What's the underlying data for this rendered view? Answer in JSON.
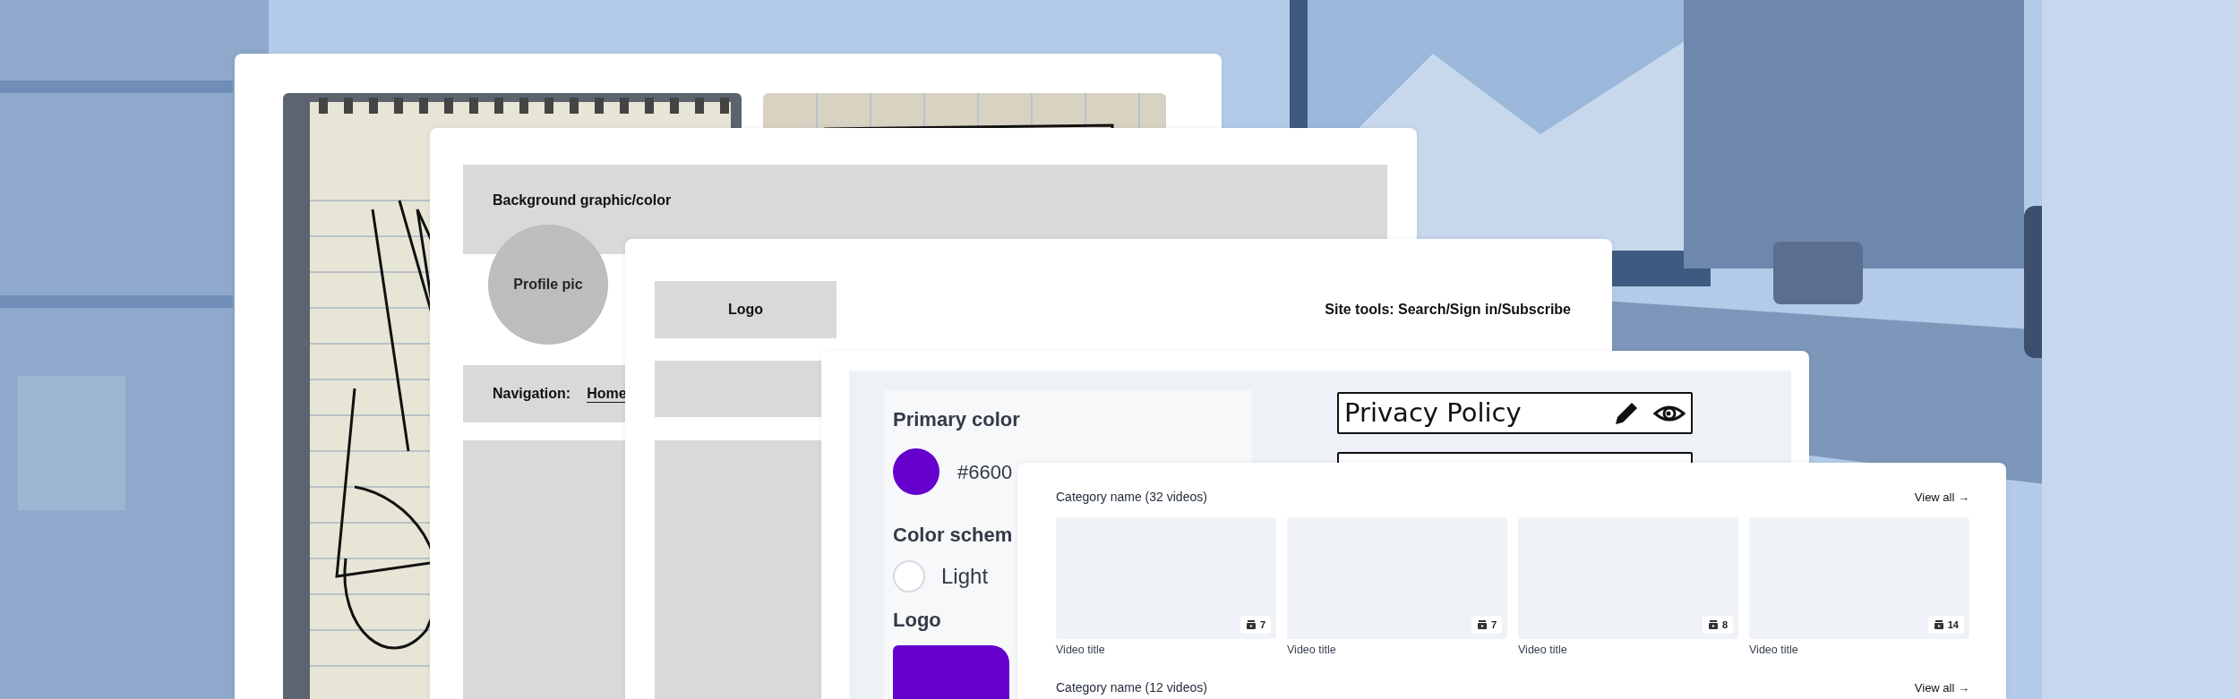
{
  "profile_wireframe": {
    "banner_label": "Background graphic/color",
    "avatar_label": "Profile pic",
    "nav_label": "Navigation:",
    "nav_links": [
      "Home"
    ]
  },
  "header_wireframe": {
    "logo_label": "Logo",
    "tools_label": "Site tools: Search/Sign in/Subscribe"
  },
  "theme_settings": {
    "primary_color": {
      "label": "Primary color",
      "color": "#6600cc",
      "value": "#6600"
    },
    "color_scheme": {
      "label": "Color schem",
      "options": [
        {
          "label": "Light",
          "selected": false
        }
      ]
    },
    "logo": {
      "label": "Logo"
    },
    "sketch_items": [
      {
        "label": "Privacy Policy"
      }
    ]
  },
  "video_categories": [
    {
      "title": "Category name (32 videos)",
      "link": "View all →",
      "videos": [
        {
          "title": "Video title",
          "count": "7"
        },
        {
          "title": "Video title",
          "count": "7"
        },
        {
          "title": "Video title",
          "count": "8"
        },
        {
          "title": "Video title",
          "count": "14"
        }
      ]
    },
    {
      "title": "Category name (12 videos)",
      "link": "View all →"
    }
  ]
}
